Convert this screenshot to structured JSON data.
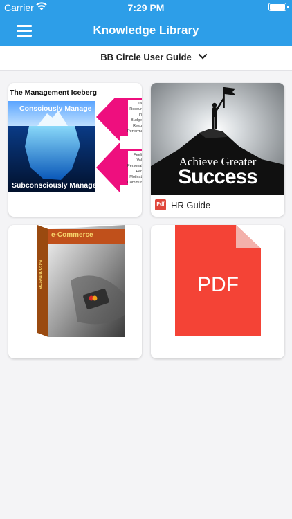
{
  "status": {
    "carrier": "Carrier",
    "time": "7:29 PM"
  },
  "header": {
    "title": "Knowledge Library"
  },
  "selector": {
    "label": "BB Circle User Guide"
  },
  "cards": [
    {
      "heading": "The Management Iceberg",
      "top_text": "Consciously Manage",
      "bottom_text": "Subconsciously Manage",
      "arrow_top": [
        "Ta",
        "Resour",
        "Tin",
        "Budge",
        "Resu",
        "Performan"
      ],
      "arrow_bottom": [
        "Feeli",
        "Val",
        "Personali",
        "Per",
        "Motivat",
        "Communicat"
      ]
    },
    {
      "top_line": "Achieve Greater",
      "main_line": "Success",
      "badge": "Pdf",
      "caption": "HR Guide"
    },
    {
      "box_label": "e-Commerce",
      "spine_label": "e-Commerce"
    },
    {
      "doc_label": "PDF"
    }
  ]
}
